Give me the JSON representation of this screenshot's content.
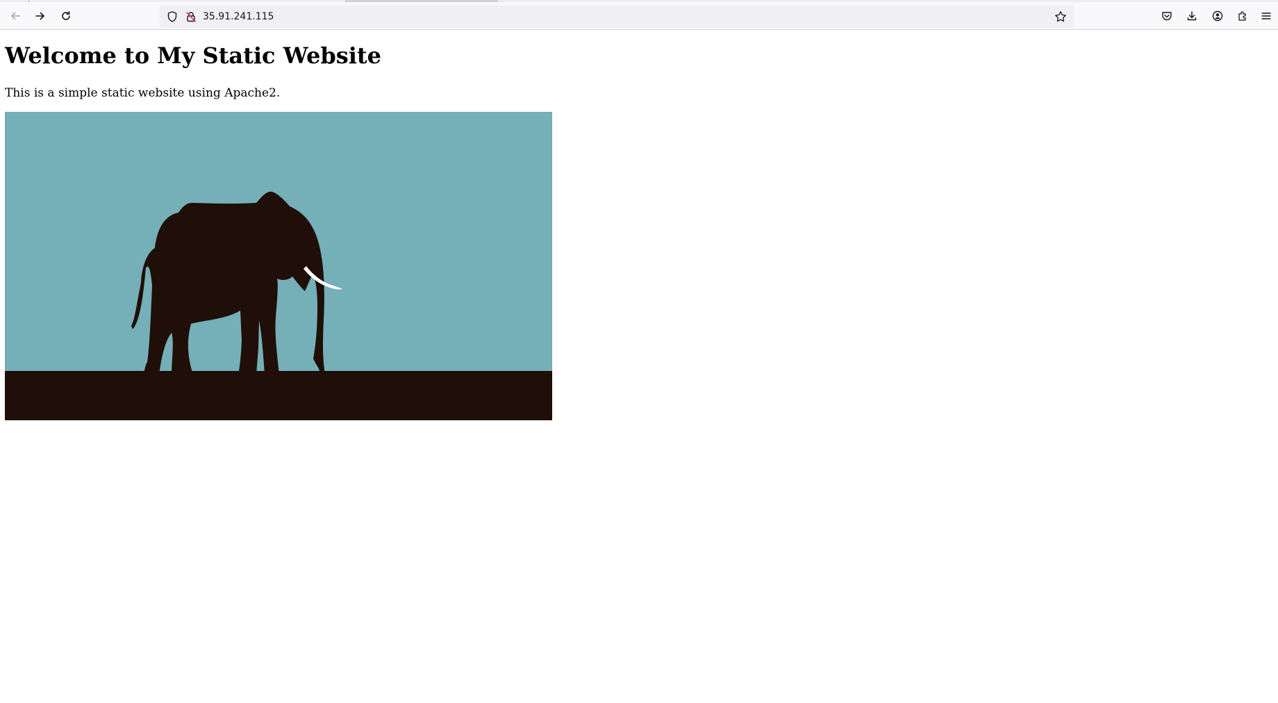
{
  "browser": {
    "url": "35.91.241.115",
    "icons": {
      "back": "back-arrow-icon",
      "forward": "forward-arrow-icon",
      "reload": "reload-icon",
      "tracking": "shield-icon",
      "insecure": "insecure-lock-icon",
      "bookmark": "star-icon",
      "pocket": "pocket-icon",
      "downloads": "download-icon",
      "account": "account-icon",
      "extensions": "extensions-icon",
      "menu": "hamburger-menu-icon"
    }
  },
  "page": {
    "heading": "Welcome to My Static Website",
    "paragraph": "This is a simple static website using Apache2.",
    "image": {
      "subject": "elephant silhouette",
      "colors": {
        "sky": "#75afb8",
        "ground": "#1f0f08",
        "elephant": "#1f0f08",
        "tusk": "#ffffff"
      }
    }
  }
}
